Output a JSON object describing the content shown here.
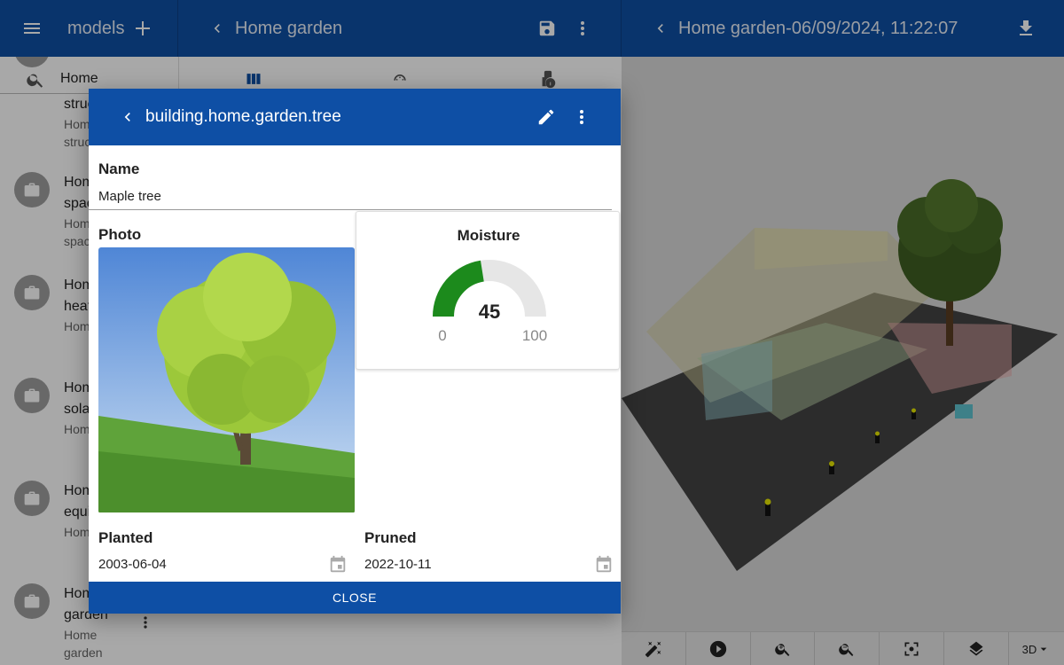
{
  "bar1": {
    "title": "models"
  },
  "bar2": {
    "title": "Home garden"
  },
  "bar3": {
    "title": "Home garden-06/09/2024, 11:22:07"
  },
  "search": {
    "value": "Home"
  },
  "list": [
    {
      "t1": "struc",
      "t2": "Home struc"
    },
    {
      "t1": "Home spac",
      "t2": "Home spac"
    },
    {
      "t1": "Home heat",
      "t2": "Home heat"
    },
    {
      "t1": "Home sola",
      "t2": "Home sola"
    },
    {
      "t1": "Home equi",
      "t2": "Home equi"
    },
    {
      "t1": "Home garden",
      "t2": "Home garden"
    }
  ],
  "dialog": {
    "title": "building.home.garden.tree",
    "name_label": "Name",
    "name_value": "Maple tree",
    "photo_label": "Photo",
    "moisture_label": "Moisture",
    "moisture_value": "45",
    "moisture_min": "0",
    "moisture_max": "100",
    "moisture_fraction": 0.45,
    "planted_label": "Planted",
    "planted_value": "2003-06-04",
    "pruned_label": "Pruned",
    "pruned_value": "2022-10-11",
    "close_label": "CLOSE"
  },
  "viewbar": {
    "mode": "3D"
  },
  "colors": {
    "primary": "#0e4fa5",
    "gauge_fill": "#1c8a1c",
    "gauge_track": "#e6e6e6"
  }
}
